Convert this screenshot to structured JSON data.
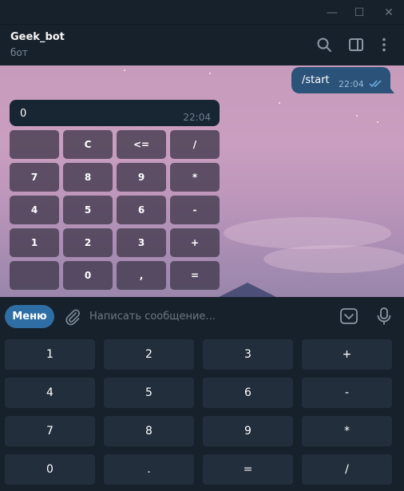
{
  "window": {
    "minimize": "—",
    "maximize": "☐",
    "close": "✕"
  },
  "header": {
    "title": "Geek_bot",
    "status": "бот",
    "icons": [
      "search-icon",
      "sidebar-icon",
      "more-vertical-icon"
    ]
  },
  "messages": {
    "outgoing": {
      "text": "/start",
      "time": "22:04",
      "status": "read"
    },
    "incoming": {
      "text": "0",
      "time": "22:04"
    }
  },
  "inline_keyboard": [
    [
      "",
      "C",
      "<=",
      "/"
    ],
    [
      "7",
      "8",
      "9",
      "*"
    ],
    [
      "4",
      "5",
      "6",
      "-"
    ],
    [
      "1",
      "2",
      "3",
      "+"
    ],
    [
      "",
      "0",
      ",",
      "="
    ]
  ],
  "composer": {
    "menu_label": "Меню",
    "placeholder": "Написать сообщение...",
    "icons": [
      "paperclip-icon",
      "keyboard-toggle-icon",
      "microphone-icon"
    ]
  },
  "reply_keyboard": [
    [
      "1",
      "2",
      "3",
      "+"
    ],
    [
      "4",
      "5",
      "6",
      "-"
    ],
    [
      "7",
      "8",
      "9",
      "*"
    ],
    [
      "0",
      ".",
      "=",
      "/"
    ]
  ],
  "colors": {
    "background": "#17212b",
    "accent": "#2f6ea5",
    "outgoing_bubble": "#2b5278",
    "incoming_bubble": "#182533",
    "key": "#232e3c"
  }
}
